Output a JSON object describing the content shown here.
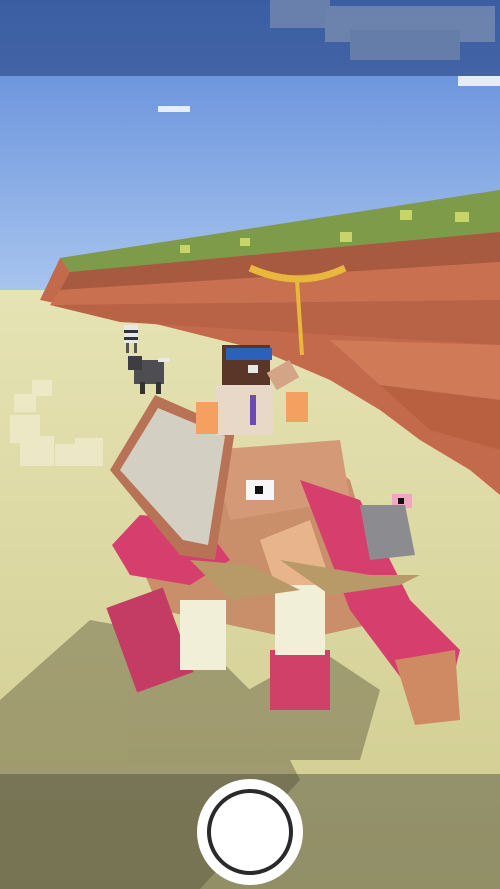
{
  "screen": {
    "mode": "photo-capture",
    "accent_colors": {
      "sky": "#6f9be0",
      "ground": "#d9d7a2",
      "cliff": "#c46a4c",
      "creature_pink": "#d83f6b",
      "shutter": "#ffffff"
    }
  },
  "controls": {
    "shutter_icon": "camera-shutter-icon"
  }
}
